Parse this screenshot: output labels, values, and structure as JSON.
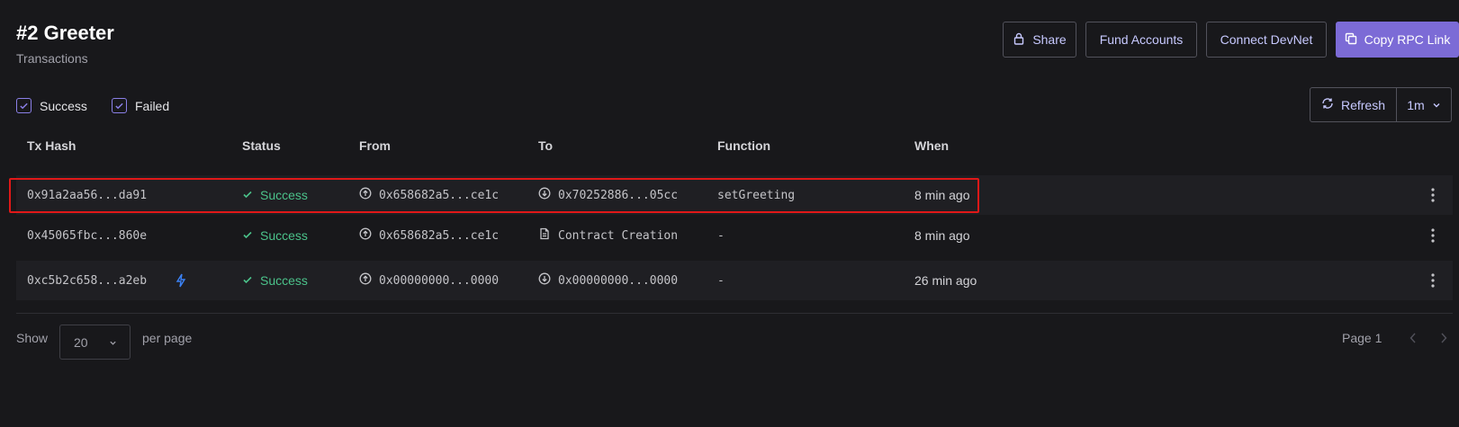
{
  "header": {
    "title": "#2 Greeter",
    "subtitle": "Transactions",
    "buttons": {
      "share": "Share",
      "fund_accounts": "Fund Accounts",
      "connect_devnet": "Connect DevNet",
      "copy_rpc_link": "Copy RPC Link"
    }
  },
  "filters": {
    "success": {
      "label": "Success",
      "checked": true
    },
    "failed": {
      "label": "Failed",
      "checked": true
    }
  },
  "toolbar": {
    "refresh_label": "Refresh",
    "interval": "1m"
  },
  "table": {
    "columns": [
      "Tx Hash",
      "Status",
      "From",
      "To",
      "Function",
      "When"
    ],
    "rows": [
      {
        "hash": "0x91a2aa56...da91",
        "status": "Success",
        "from": "0x658682a5...ce1c",
        "to": "0x70252886...05cc",
        "to_type": "address",
        "function": "setGreeting",
        "when": "8 min ago",
        "highlighted": true
      },
      {
        "hash": "0x45065fbc...860e",
        "status": "Success",
        "from": "0x658682a5...ce1c",
        "to": "Contract Creation",
        "to_type": "contract",
        "function": "-",
        "when": "8 min ago"
      },
      {
        "hash": "0xc5b2c658...a2eb",
        "status": "Success",
        "from": "0x00000000...0000",
        "to": "0x00000000...0000",
        "to_type": "address",
        "function": "-",
        "when": "26 min ago",
        "icon": "bolt-icon"
      }
    ]
  },
  "pagination": {
    "show_label": "Show",
    "per_page": "20",
    "per_page_label": "per page",
    "page_label": "Page 1"
  },
  "colors": {
    "background": "#18181b",
    "accent": "#7c6bd6",
    "success": "#4bc28a",
    "highlight": "#e01818"
  }
}
